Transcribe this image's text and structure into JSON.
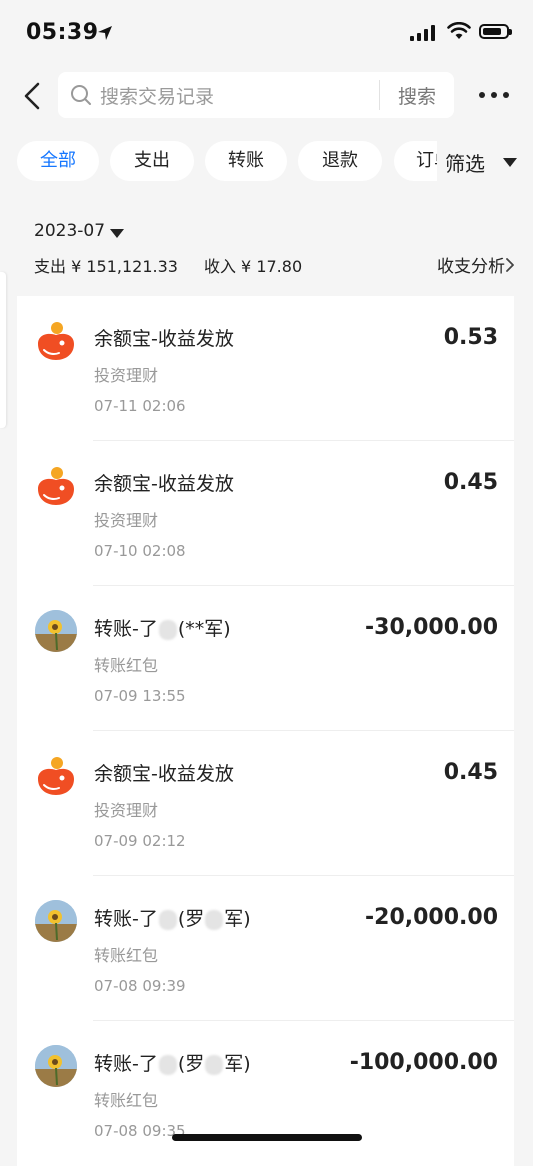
{
  "status_bar": {
    "time": "05:39"
  },
  "header": {
    "search_placeholder": "搜索交易记录",
    "search_button": "搜索"
  },
  "chips": [
    "全部",
    "支出",
    "转账",
    "退款",
    "订单"
  ],
  "filter_label": "筛选",
  "summary": {
    "month": "2023-07",
    "expense": "支出 ¥ 151,121.33",
    "income": "收入 ¥ 17.80",
    "analysis": "收支分析"
  },
  "transactions": [
    {
      "icon": "yuebao-logo-icon",
      "title": "余额宝-收益发放",
      "category": "投资理财",
      "datetime": "07-11 02:06",
      "amount": "0.53"
    },
    {
      "icon": "yuebao-logo-icon",
      "title": "余额宝-收益发放",
      "category": "投资理财",
      "datetime": "07-10 02:08",
      "amount": "0.45"
    },
    {
      "icon": "sunflower-avatar",
      "title_prefix": "转账-了",
      "title_suffix": "(**军)",
      "category": "转账红包",
      "datetime": "07-09 13:55",
      "amount": "-30,000.00"
    },
    {
      "icon": "yuebao-logo-icon",
      "title": "余额宝-收益发放",
      "category": "投资理财",
      "datetime": "07-09 02:12",
      "amount": "0.45"
    },
    {
      "icon": "sunflower-avatar",
      "title_prefix": "转账-了",
      "title_mid": "(罗",
      "title_suffix": "军)",
      "category": "转账红包",
      "datetime": "07-08 09:39",
      "amount": "-20,000.00"
    },
    {
      "icon": "sunflower-avatar",
      "title_prefix": "转账-了",
      "title_mid": "(罗",
      "title_suffix": "军)",
      "category": "转账红包",
      "datetime": "07-08 09:35",
      "amount": "-100,000.00"
    }
  ]
}
